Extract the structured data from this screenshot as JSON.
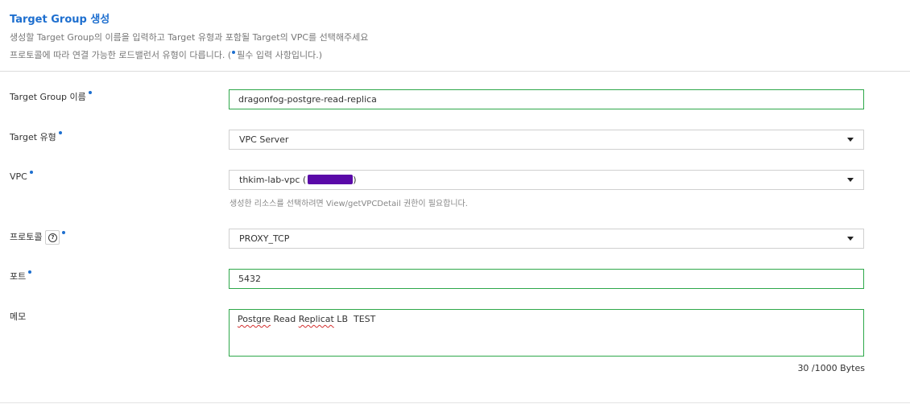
{
  "header": {
    "title": "Target Group 생성",
    "description_line1": "생성할 Target Group의 이름을 입력하고 Target 유형과 포함될 Target의 VPC를 선택해주세요",
    "description_line2_prefix": "프로토콜에 따라 연결 가능한 로드밸런서 유형이 다릅니다. (",
    "description_line2_suffix": "필수 입력 사항입니다.)"
  },
  "form": {
    "name": {
      "label": "Target Group 이름",
      "value": "dragonfog-postgre-read-replica"
    },
    "target_type": {
      "label": "Target 유형",
      "value": "VPC Server"
    },
    "vpc": {
      "label": "VPC",
      "value": "thkim-lab-vpc (",
      "value_close": ")",
      "hint": "생성한 리소스를 선택하려면 View/getVPCDetail 권한이 필요합니다."
    },
    "protocol": {
      "label": "프로토콜",
      "help_icon_text": "?",
      "value": "PROXY_TCP"
    },
    "port": {
      "label": "포트",
      "value": "5432"
    },
    "memo": {
      "label": "메모",
      "words": [
        "Postgre",
        " Read ",
        "Replicat",
        " LB  TEST"
      ],
      "counter": "30 /1000 Bytes"
    }
  },
  "colors": {
    "accent": "#1e6fcf",
    "input_border_active": "#2ea84a",
    "redaction": "#5a0aa8"
  },
  "icons": [
    "help-icon",
    "chevron-down-icon",
    "required-dot-icon"
  ]
}
